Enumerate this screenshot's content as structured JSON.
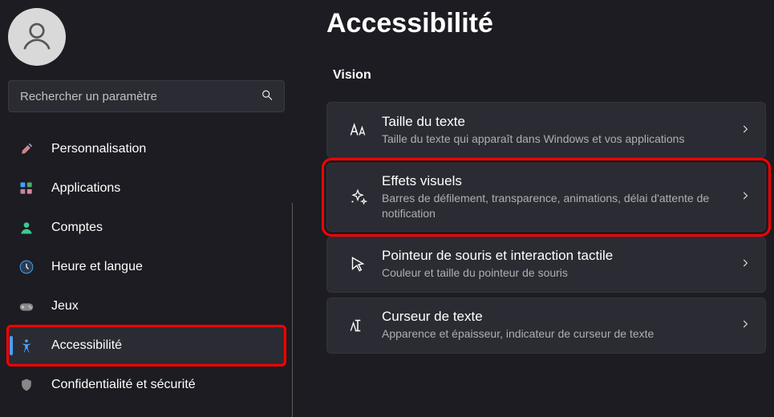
{
  "page_title": "Accessibilité",
  "search": {
    "placeholder": "Rechercher un paramètre"
  },
  "sidebar": {
    "items": [
      {
        "label": "Personnalisation",
        "icon": "brush-icon"
      },
      {
        "label": "Applications",
        "icon": "apps-icon"
      },
      {
        "label": "Comptes",
        "icon": "person-icon"
      },
      {
        "label": "Heure et langue",
        "icon": "clock-icon"
      },
      {
        "label": "Jeux",
        "icon": "gamepad-icon"
      },
      {
        "label": "Accessibilité",
        "icon": "accessibility-icon"
      },
      {
        "label": "Confidentialité et sécurité",
        "icon": "shield-icon"
      }
    ]
  },
  "main": {
    "section_heading": "Vision",
    "cards": [
      {
        "title": "Taille du texte",
        "subtitle": "Taille du texte qui apparaît dans Windows et vos applications",
        "icon": "text-size-icon"
      },
      {
        "title": "Effets visuels",
        "subtitle": "Barres de défilement, transparence, animations, délai d'attente de notification",
        "icon": "sparkles-icon"
      },
      {
        "title": "Pointeur de souris et interaction tactile",
        "subtitle": "Couleur et taille du pointeur de souris",
        "icon": "mouse-pointer-icon"
      },
      {
        "title": "Curseur de texte",
        "subtitle": "Apparence et épaisseur, indicateur de curseur de texte",
        "icon": "text-cursor-icon"
      }
    ]
  }
}
